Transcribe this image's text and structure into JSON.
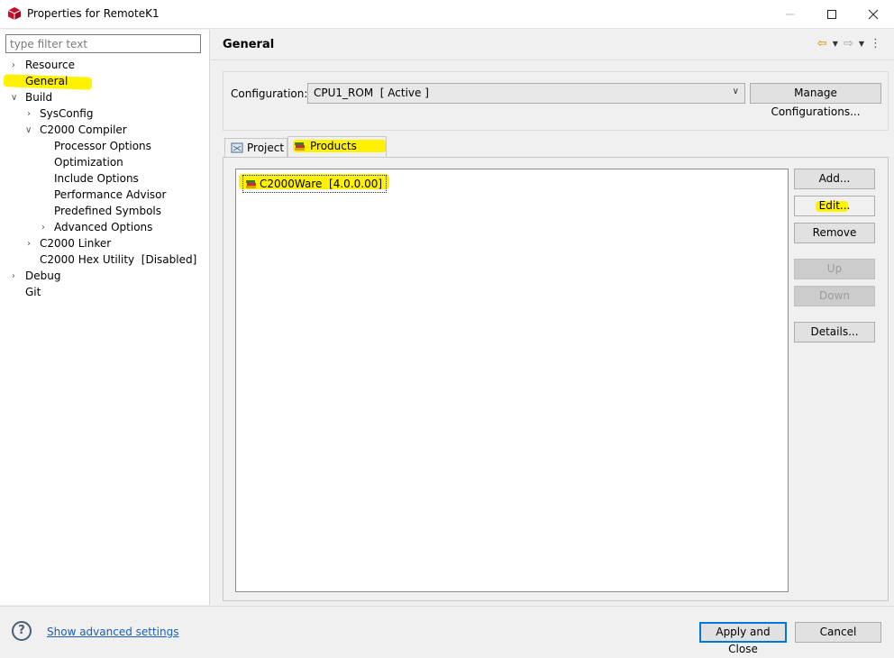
{
  "window": {
    "title": "Properties for RemoteK1"
  },
  "sidebar": {
    "filter_placeholder": "type filter text",
    "items": [
      {
        "label": "Resource"
      },
      {
        "label": "General"
      },
      {
        "label": "Build"
      },
      {
        "label": "SysConfig"
      },
      {
        "label": "C2000 Compiler"
      },
      {
        "label": "Processor Options"
      },
      {
        "label": "Optimization"
      },
      {
        "label": "Include Options"
      },
      {
        "label": "Performance Advisor"
      },
      {
        "label": "Predefined Symbols"
      },
      {
        "label": "Advanced Options"
      },
      {
        "label": "C2000 Linker"
      },
      {
        "label": "C2000 Hex Utility  [Disabled]"
      },
      {
        "label": "Debug"
      },
      {
        "label": "Git"
      }
    ]
  },
  "main": {
    "title": "General",
    "config_label": "Configuration:",
    "config_value": "CPU1_ROM  [ Active ]",
    "manage_button": "Manage Configurations...",
    "tabs": [
      {
        "label": "Project"
      },
      {
        "label": "Products"
      }
    ],
    "products": [
      "C2000Ware  [4.0.0.00]"
    ],
    "buttons": {
      "add": "Add...",
      "edit": "Edit...",
      "remove": "Remove",
      "up": "Up",
      "down": "Down",
      "details": "Details..."
    }
  },
  "footer": {
    "help": "?",
    "advanced_link": "Show advanced settings",
    "apply_close": "Apply and Close",
    "cancel": "Cancel"
  },
  "colors": {
    "highlight": "#fff200",
    "link": "#1a5fb4",
    "focus": "#0078d7"
  }
}
